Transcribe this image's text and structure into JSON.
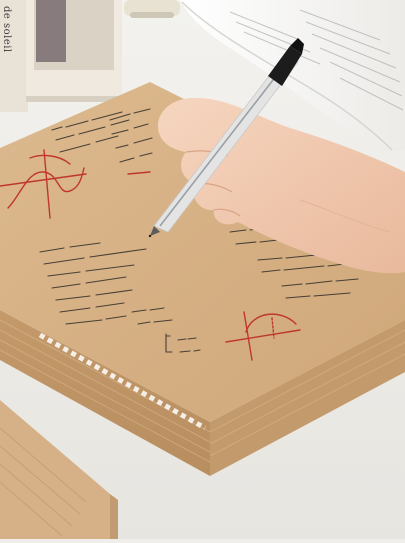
{
  "book": {
    "spine_text": "de soleil"
  },
  "colors": {
    "desk": "#efeeea",
    "kraft_paper": "#d8b48a",
    "kraft_edge": "#c99f72",
    "ink_black": "#2a2a2a",
    "ink_red": "#c0362f",
    "skin": "#f2cdb4",
    "pen_body": "#e6e6e6",
    "pen_cap": "#1c1c1c"
  },
  "objects": [
    "wooden-shelf",
    "open-book",
    "kraft-notepad-stack",
    "hand",
    "gel-pen",
    "small-kraft-notebook"
  ]
}
